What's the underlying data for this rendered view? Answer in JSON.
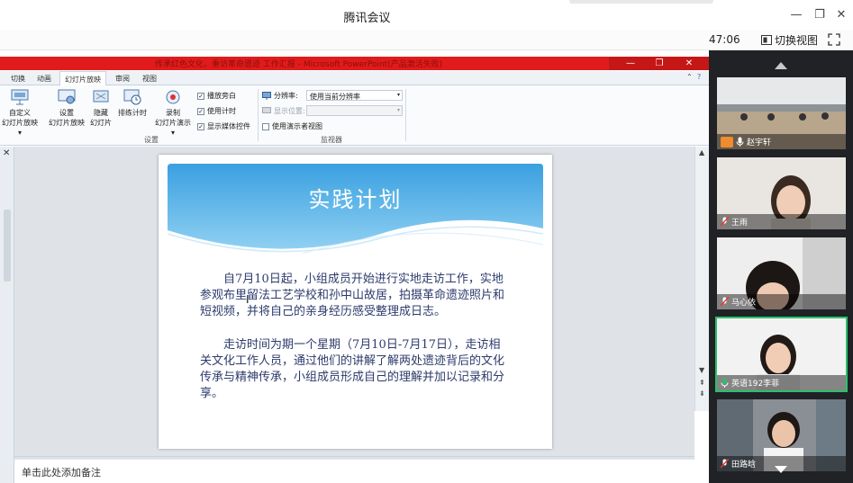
{
  "meeting": {
    "title": "腾讯会议",
    "timer": "47:06",
    "switch_view_label": "切换视图"
  },
  "ppt": {
    "window_title": "传承红色文化，重访革命遗迹  工作汇报 - Microsoft PowerPoint(产品激活失败)",
    "tabs": [
      "切换",
      "动画",
      "幻灯片放映",
      "审阅",
      "视图"
    ],
    "active_tab": "幻灯片放映",
    "ribbon": {
      "custom_show_label": "自定义\n幻灯片放映",
      "setup_label": "设置\n幻灯片放映",
      "hide_label": "隐藏\n幻灯片",
      "rehearse_label": "排练计时",
      "record_label": "录制\n幻灯片演示",
      "play_narration": "播放旁白",
      "use_timings": "使用计时",
      "show_media_controls": "显示媒体控件",
      "group_setup": "设置",
      "resolution_label": "分辨率:",
      "resolution_value": "使用当前分辨率",
      "show_on_label": "显示位置:",
      "presenter_view": "使用演示者视图",
      "group_monitors": "监视器"
    },
    "notes_placeholder": "单击此处添加备注"
  },
  "slide": {
    "title": "实践计划",
    "paragraph1": "自7月10日起，小组成员开始进行实地走访工作，实地参观布里留法工艺学校和孙中山故居，拍摄革命遗迹照片和短视频，并将自己的亲身经历感受整理成日志。",
    "paragraph2": "走访时间为期一个星期（7月10日-7月17日），走访相关文化工作人员，通过他们的讲解了解两处遗迹背后的文化传承与精神传承，小组成员形成自己的理解并加以记录和分享。"
  },
  "participants": [
    {
      "name": "赵宇轩",
      "active": false
    },
    {
      "name": "王雨",
      "active": false
    },
    {
      "name": "马心依",
      "active": false
    },
    {
      "name": "英语192李菲",
      "active": true
    },
    {
      "name": "田路晗",
      "active": false
    }
  ],
  "colors": {
    "ppt_title_red": "#e11b1b",
    "slide_text": "#2d3b6c",
    "active_speaker": "#2bc06a"
  }
}
